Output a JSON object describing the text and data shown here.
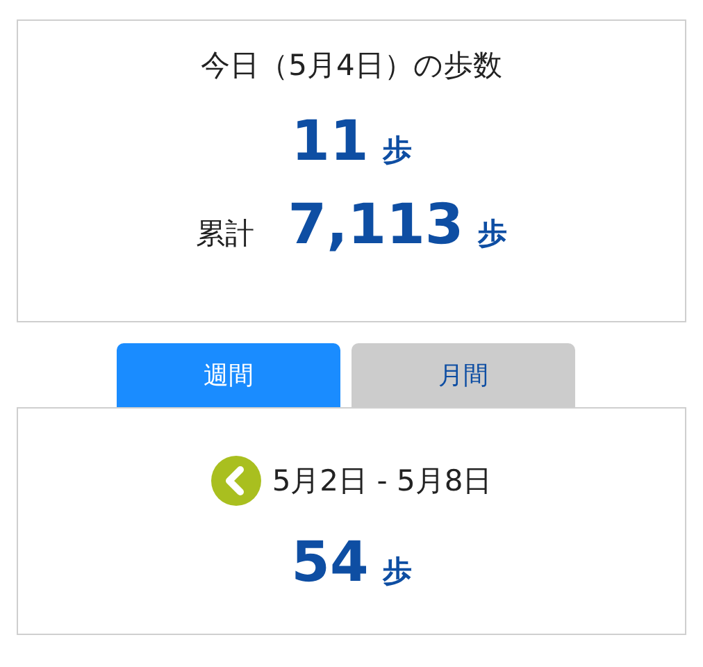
{
  "today": {
    "title": "今日（5月4日）の歩数",
    "steps": "11",
    "unit": "歩",
    "total_label": "累計",
    "total": "7,113",
    "total_unit": "歩"
  },
  "tabs": [
    {
      "label": "週間",
      "selected": true
    },
    {
      "label": "月間",
      "selected": false
    }
  ],
  "period": {
    "range": "5月2日 - 5月8日",
    "steps": "54",
    "unit": "歩"
  }
}
